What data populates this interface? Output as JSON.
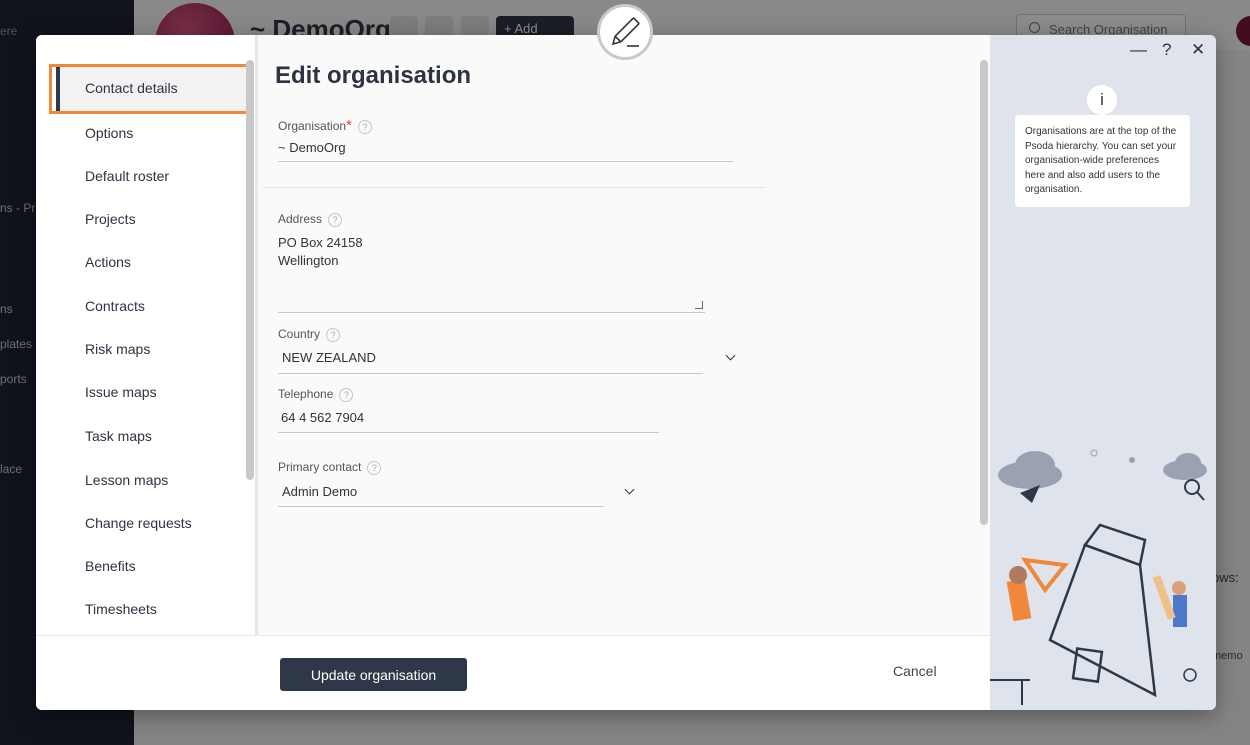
{
  "background": {
    "org_title": "~ DemoOrg",
    "add_label": "Add",
    "search_placeholder": "Search Organisation",
    "sidebar_fragments": [
      "ere",
      "ns - Pr",
      "ns",
      "plates",
      "ports",
      "lace"
    ],
    "rows_fragment": "ows:",
    "memo_fragment": "memo"
  },
  "modal": {
    "title": "Edit organisation",
    "nav": [
      {
        "label": "Contact details",
        "active": true
      },
      {
        "label": "Options"
      },
      {
        "label": "Default roster"
      },
      {
        "label": "Projects"
      },
      {
        "label": "Actions"
      },
      {
        "label": "Contracts"
      },
      {
        "label": "Risk maps"
      },
      {
        "label": "Issue maps"
      },
      {
        "label": "Task maps"
      },
      {
        "label": "Lesson maps"
      },
      {
        "label": "Change requests"
      },
      {
        "label": "Benefits"
      },
      {
        "label": "Timesheets"
      }
    ],
    "fields": {
      "organisation": {
        "label": "Organisation",
        "required_mark": "*",
        "value": "~ DemoOrg"
      },
      "address": {
        "label": "Address",
        "line1": "PO Box 24158",
        "line2": "Wellington"
      },
      "country": {
        "label": "Country",
        "value": "NEW ZEALAND"
      },
      "telephone": {
        "label": "Telephone",
        "value": "64 4 562 7904"
      },
      "primary_contact": {
        "label": "Primary contact",
        "value": "Admin Demo"
      }
    },
    "help_glyph": "?",
    "footer": {
      "update_label": "Update organisation",
      "cancel_label": "Cancel"
    },
    "side_panel": {
      "minimize_glyph": "—",
      "help_glyph": "?",
      "close_glyph": "✕",
      "info_glyph": "i",
      "info_text": "Organisations are at the top of the Psoda hierarchy. You can set your organisation-wide preferences here and also add users to the organisation."
    }
  },
  "colors": {
    "accent_orange": "#f0883c",
    "primary_dark": "#2f3848",
    "required_red": "#e0463a"
  }
}
